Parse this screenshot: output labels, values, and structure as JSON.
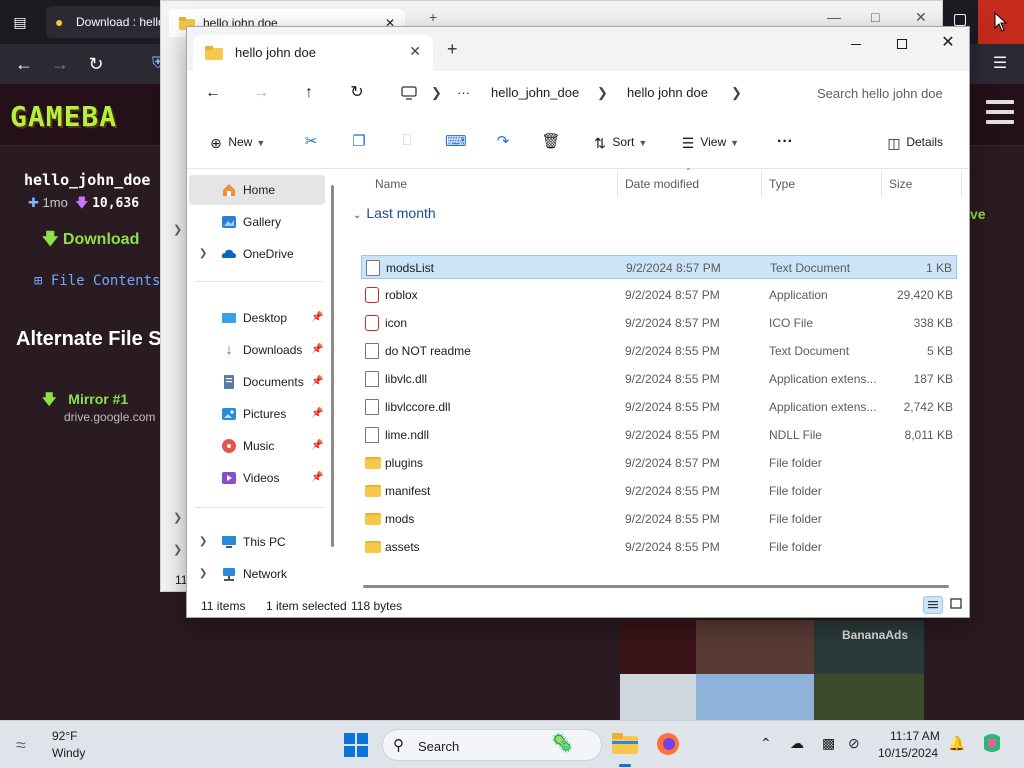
{
  "browser": {
    "tab_title": "Download : hello",
    "site": {
      "logo": "GAMEBA",
      "username": "hello_john_doe",
      "age": "1mo",
      "downloads": "10,636",
      "download_label": "Download",
      "file_contents_label": "File Contents",
      "alt_heading": "Alternate File S",
      "mirror_label": "Mirror #1",
      "mirror_url": "drive.google.com",
      "right_fragment": "ve",
      "ad_label": "BananaAds"
    }
  },
  "explorer_back": {
    "tab_title": "hello john doe",
    "row_hint": "11"
  },
  "explorer": {
    "tab_title": "hello john doe",
    "address": {
      "more": "···",
      "crumbs": [
        "hello_john_doe",
        "hello john doe"
      ]
    },
    "search_placeholder": "Search hello john doe",
    "toolbar": {
      "new": "New",
      "sort": "Sort",
      "view": "View",
      "more": "···",
      "details": "Details"
    },
    "sidebar": {
      "items": [
        {
          "label": "Home",
          "icon": "home-icon"
        },
        {
          "label": "Gallery",
          "icon": "gallery-icon"
        },
        {
          "label": "OneDrive",
          "icon": "cloud-icon"
        },
        {
          "label": "Desktop",
          "icon": "desktop-icon"
        },
        {
          "label": "Downloads",
          "icon": "download-icon"
        },
        {
          "label": "Documents",
          "icon": "documents-icon"
        },
        {
          "label": "Pictures",
          "icon": "pictures-icon"
        },
        {
          "label": "Music",
          "icon": "music-icon"
        },
        {
          "label": "Videos",
          "icon": "videos-icon"
        },
        {
          "label": "This PC",
          "icon": "pc-icon"
        },
        {
          "label": "Network",
          "icon": "network-icon"
        }
      ]
    },
    "columns": {
      "name": "Name",
      "date": "Date modified",
      "type": "Type",
      "size": "Size"
    },
    "group": "Last month",
    "files": [
      {
        "name": "modsList",
        "date": "9/2/2024 8:57 PM",
        "type": "Text Document",
        "size": "1 KB",
        "icon": "text-file-icon",
        "selected": true
      },
      {
        "name": "roblox",
        "date": "9/2/2024 8:57 PM",
        "type": "Application",
        "size": "29,420 KB",
        "icon": "app-icon"
      },
      {
        "name": "icon",
        "date": "9/2/2024 8:57 PM",
        "type": "ICO File",
        "size": "338 KB",
        "icon": "app-icon"
      },
      {
        "name": "do NOT readme",
        "date": "9/2/2024 8:55 PM",
        "type": "Text Document",
        "size": "5 KB",
        "icon": "text-file-icon"
      },
      {
        "name": "libvlc.dll",
        "date": "9/2/2024 8:55 PM",
        "type": "Application extens...",
        "size": "187 KB",
        "icon": "dll-icon"
      },
      {
        "name": "libvlccore.dll",
        "date": "9/2/2024 8:55 PM",
        "type": "Application extens...",
        "size": "2,742 KB",
        "icon": "dll-icon"
      },
      {
        "name": "lime.ndll",
        "date": "9/2/2024 8:55 PM",
        "type": "NDLL File",
        "size": "8,011 KB",
        "icon": "file-icon"
      },
      {
        "name": "plugins",
        "date": "9/2/2024 8:57 PM",
        "type": "File folder",
        "size": "",
        "icon": "folder-icon"
      },
      {
        "name": "manifest",
        "date": "9/2/2024 8:55 PM",
        "type": "File folder",
        "size": "",
        "icon": "folder-icon"
      },
      {
        "name": "mods",
        "date": "9/2/2024 8:55 PM",
        "type": "File folder",
        "size": "",
        "icon": "folder-icon"
      },
      {
        "name": "assets",
        "date": "9/2/2024 8:55 PM",
        "type": "File folder",
        "size": "",
        "icon": "folder-icon"
      }
    ],
    "status": {
      "count": "11 items",
      "selection": "1 item selected",
      "bytes": "118 bytes"
    }
  },
  "taskbar": {
    "temp": "92°F",
    "condition": "Windy",
    "search": "Search",
    "time": "11:17 AM",
    "date": "10/15/2024"
  }
}
